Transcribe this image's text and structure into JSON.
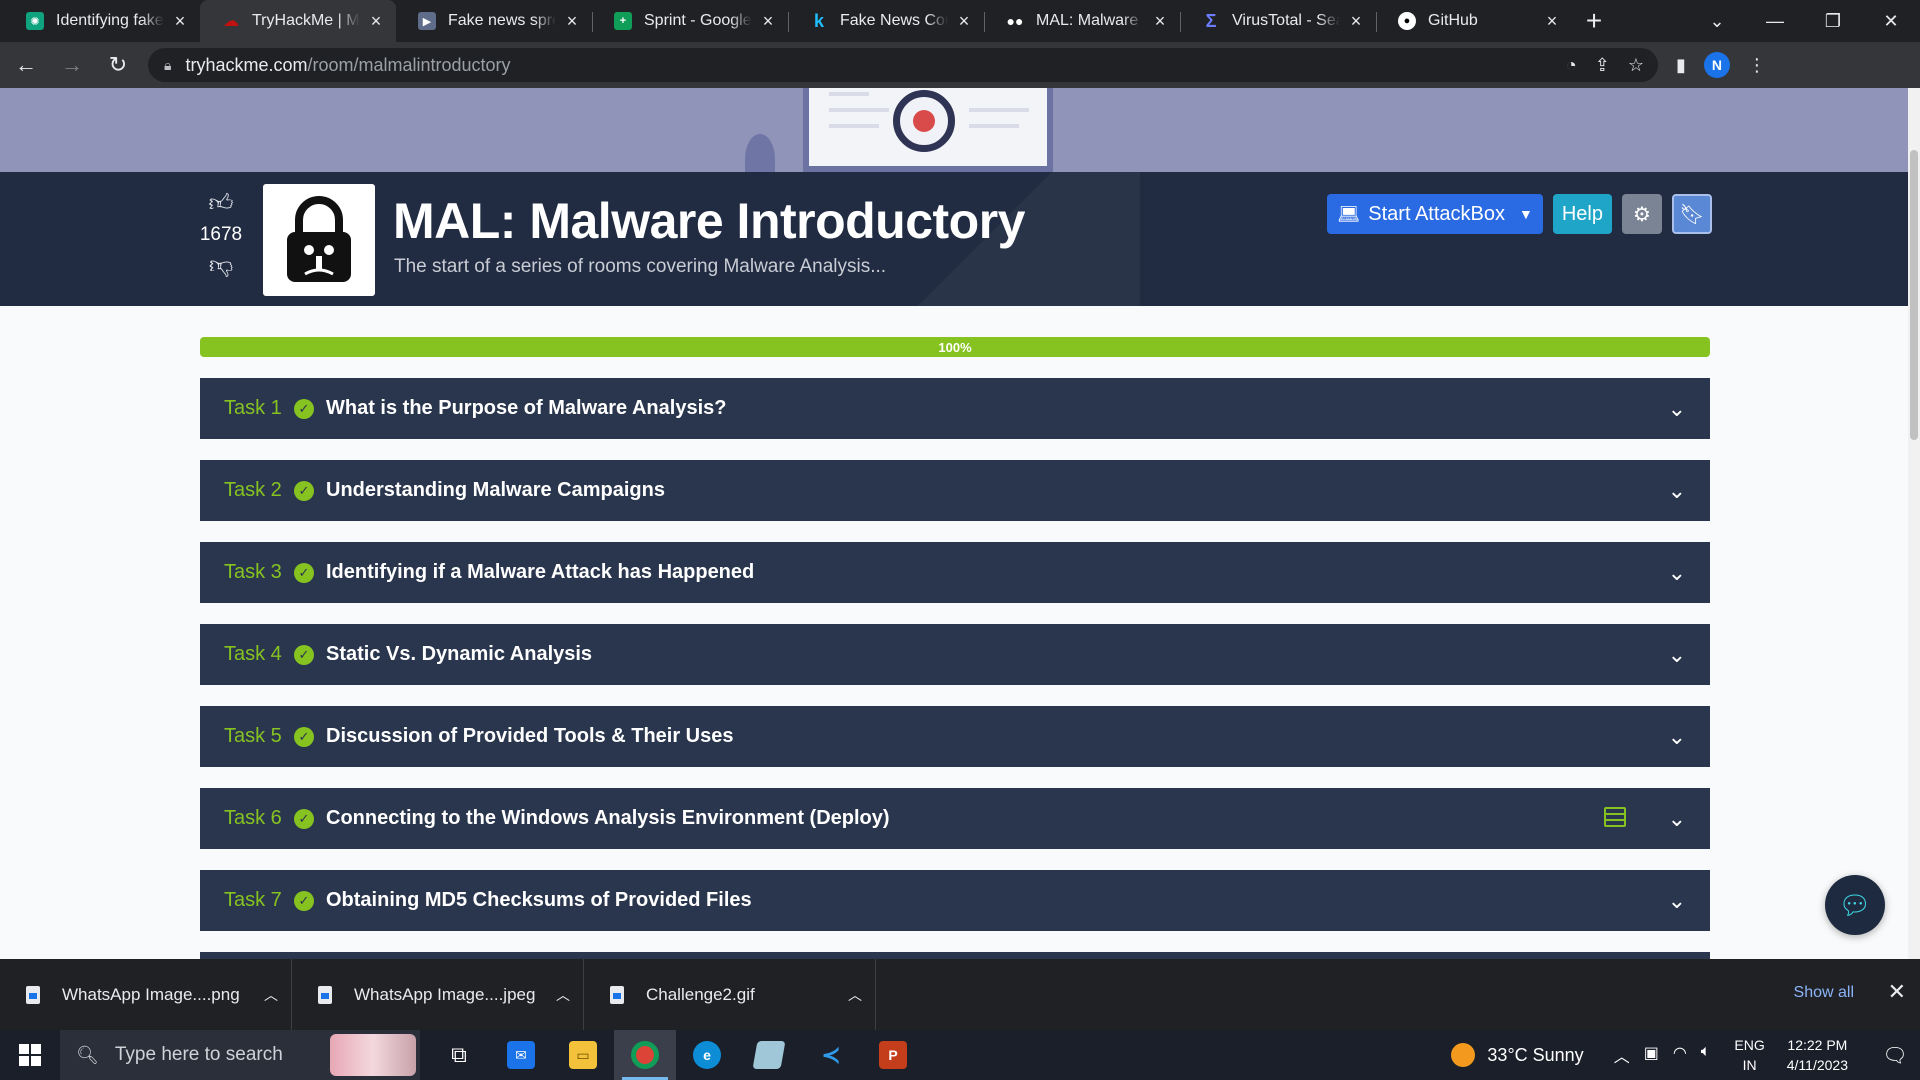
{
  "browser": {
    "tabs": [
      {
        "title": "Identifying fake news",
        "favicon": "chatgpt-icon",
        "color": "#10a37f",
        "active": false
      },
      {
        "title": "TryHackMe | MAL: Malware",
        "favicon": "tryhackme-icon",
        "color": "#c11111",
        "active": true
      },
      {
        "title": "Fake news spreaders",
        "favicon": "document-icon",
        "color": "#5f6c8a",
        "active": false
      },
      {
        "title": "Sprint - Google Sheets",
        "favicon": "sheets-icon",
        "color": "#0f9d58",
        "active": false
      },
      {
        "title": "Fake News Content",
        "favicon": "kaggle-icon",
        "color": "#20beff",
        "active": false
      },
      {
        "title": "MAL: Malware Intro",
        "favicon": "medium-icon",
        "color": "#000000",
        "active": false
      },
      {
        "title": "VirusTotal - Search",
        "favicon": "virustotal-icon",
        "color": "#394eff",
        "active": false
      },
      {
        "title": "GitHub",
        "favicon": "github-icon",
        "color": "#ffffff",
        "active": false
      }
    ],
    "url_domain": "tryhackme.com",
    "url_path": "/room/malmalintroductory",
    "profile_initial": "N"
  },
  "room": {
    "votes": "1678",
    "title": "MAL: Malware Introductory",
    "subtitle": "The start of a series of rooms covering Malware Analysis...",
    "start_attackbox": "Start AttackBox",
    "help": "Help",
    "progress_label": "100%",
    "progress_value": 100
  },
  "tasks": [
    {
      "number": "Task 1",
      "title": "What is the Purpose of Malware Analysis?",
      "completed": true
    },
    {
      "number": "Task 2",
      "title": "Understanding Malware Campaigns",
      "completed": true
    },
    {
      "number": "Task 3",
      "title": "Identifying if a Malware Attack has Happened",
      "completed": true
    },
    {
      "number": "Task 4",
      "title": "Static Vs. Dynamic Analysis",
      "completed": true
    },
    {
      "number": "Task 5",
      "title": "Discussion of Provided Tools & Their Uses",
      "completed": true
    },
    {
      "number": "Task 6",
      "title": "Connecting to the Windows Analysis Environment (Deploy)",
      "completed": true,
      "has_machine": true
    },
    {
      "number": "Task 7",
      "title": "Obtaining MD5 Checksums of Provided Files",
      "completed": true
    }
  ],
  "downloads": {
    "items": [
      {
        "name": "WhatsApp Image....png"
      },
      {
        "name": "WhatsApp Image....jpeg"
      },
      {
        "name": "Challenge2.gif"
      }
    ],
    "show_all": "Show all"
  },
  "taskbar": {
    "search_placeholder": "Type here to search",
    "weather": "33°C  Sunny",
    "lang_top": "ENG",
    "lang_bottom": "IN",
    "time": "12:22 PM",
    "date": "4/11/2023"
  }
}
